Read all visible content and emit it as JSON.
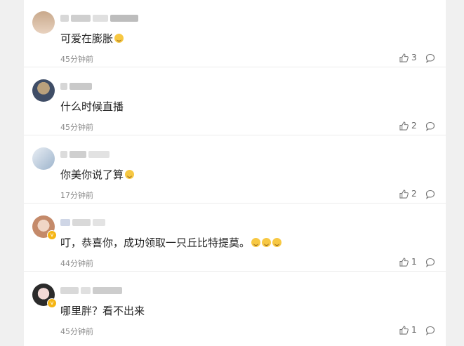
{
  "comments": [
    {
      "content": "可爱在膨胀",
      "emoji_count": 1,
      "time": "45分钟前",
      "likes": "3",
      "verified": false,
      "avatar_colors": [
        "#c9a98c",
        "#e8d2bf"
      ],
      "name_blocks": [
        "#d8d8d8",
        "#cfcfcf",
        "#e0e0e0",
        "#bdbdbd"
      ]
    },
    {
      "content": "什么时候直播",
      "emoji_count": 0,
      "time": "45分钟前",
      "likes": "2",
      "verified": false,
      "avatar_colors": [
        "#3f4d66",
        "#b9a07c"
      ],
      "name_blocks": [
        "#d6d6d6",
        "#c9c9c9"
      ]
    },
    {
      "content": "你美你说了算",
      "emoji_count": 1,
      "time": "17分钟前",
      "likes": "2",
      "verified": false,
      "avatar_colors": [
        "#9db4cc",
        "#e9eef4"
      ],
      "name_blocks": [
        "#dcdcdc",
        "#cfcfcf",
        "#e2e2e2"
      ]
    },
    {
      "content": "叮，恭喜你，成功领取一只丘比特提莫。",
      "emoji_count": 3,
      "time": "44分钟前",
      "likes": "1",
      "verified": true,
      "avatar_colors": [
        "#c48a6a",
        "#f0d6c6"
      ],
      "name_blocks": [
        "#cfd6e6",
        "#d9d9d9",
        "#e3e3e3"
      ]
    },
    {
      "content": "哪里胖？看不出来",
      "emoji_count": 0,
      "time": "45分钟前",
      "likes": "1",
      "verified": true,
      "avatar_colors": [
        "#2b2b2b",
        "#f2d9d6"
      ],
      "name_blocks": [
        "#d9d9d9",
        "#e0e0e0",
        "#cdcdcd"
      ]
    }
  ],
  "icons": {
    "like": "thumbs-up-icon",
    "reply": "comment-icon"
  }
}
